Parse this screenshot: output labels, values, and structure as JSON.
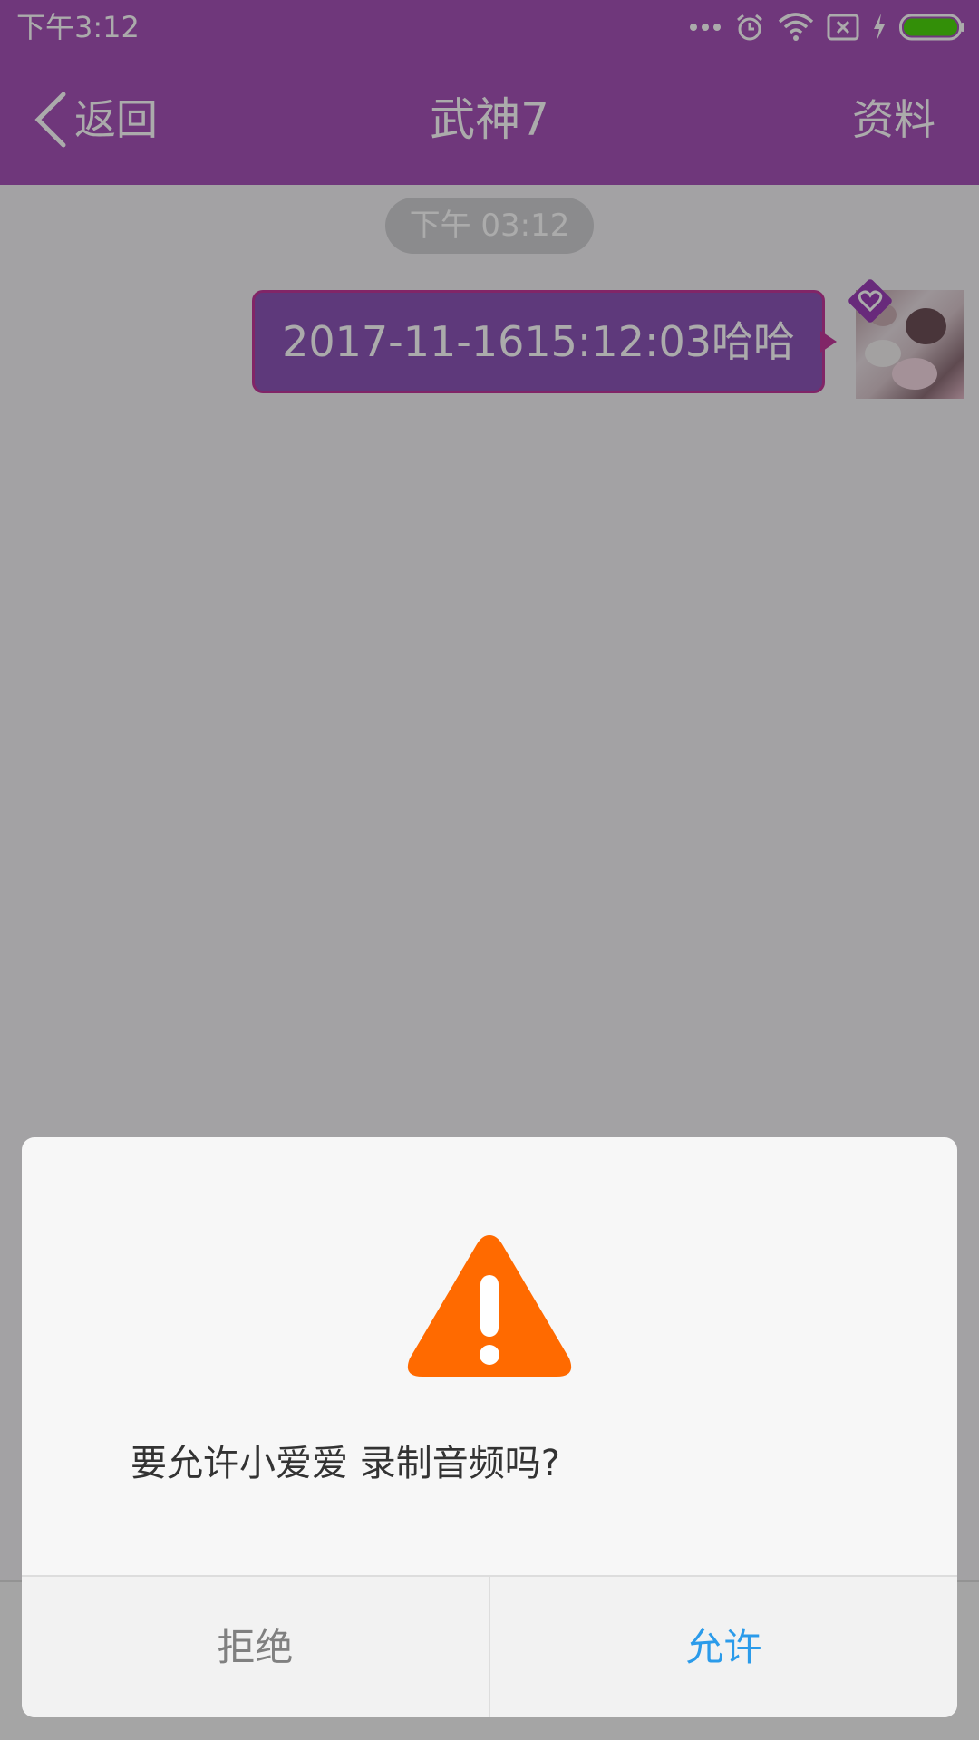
{
  "status_bar": {
    "time": "下午3:12",
    "icons": [
      "more-dots-icon",
      "alarm-icon",
      "wifi-icon",
      "no-sim-icon",
      "charging-icon",
      "battery-icon"
    ]
  },
  "nav": {
    "back_label": "返回",
    "title": "武神7",
    "right_label": "资料"
  },
  "chat": {
    "timestamp": "下午 03:12",
    "messages": [
      {
        "text": "2017-11-1615:12:03哈哈",
        "side": "right"
      }
    ]
  },
  "dialog": {
    "message": "要允许小爱爱 录制音频吗?",
    "deny_label": "拒绝",
    "allow_label": "允许"
  },
  "colors": {
    "brand": "#a652b8",
    "bubble": "#8c56b8",
    "warning": "#ff6a00",
    "allow": "#2b9bea",
    "battery": "#4cd60c"
  }
}
